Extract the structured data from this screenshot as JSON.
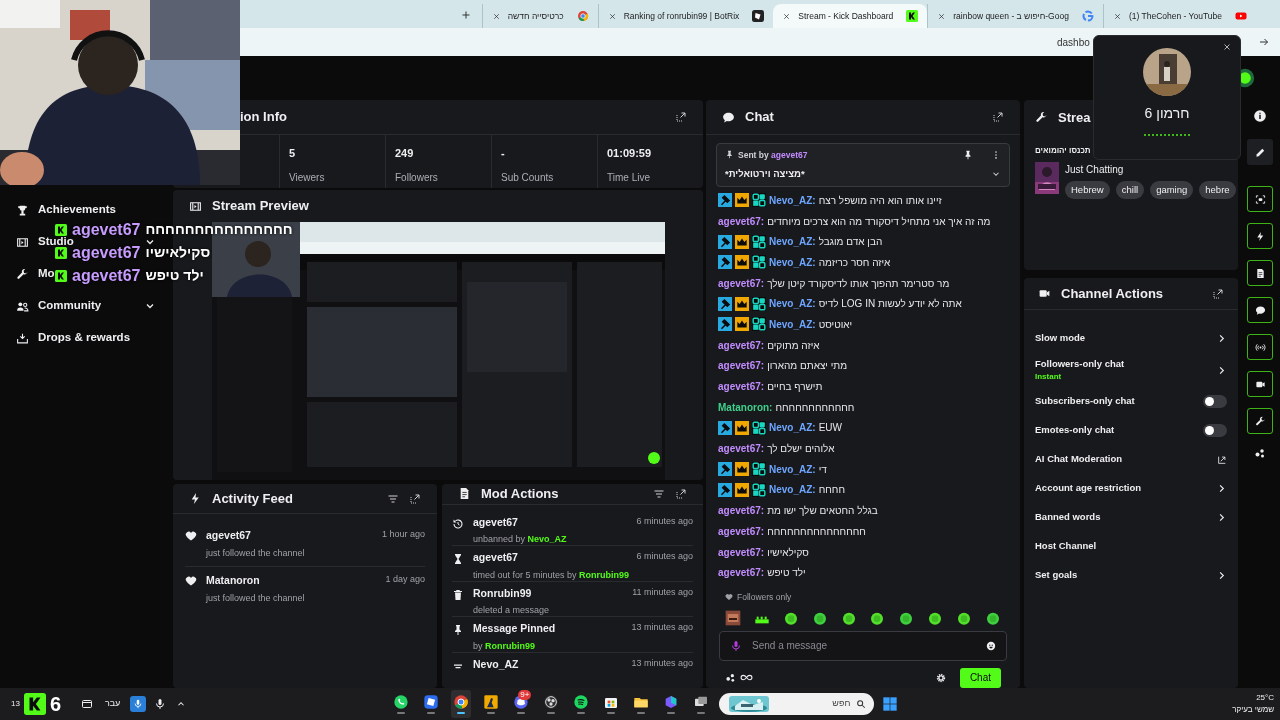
{
  "browser": {
    "tabs": [
      {
        "title": "כרטיסייה חדשה",
        "kind": "chrome",
        "selected": false
      },
      {
        "title": "Ranking of ronrubin99 | BotRix",
        "kind": "botrix",
        "selected": false
      },
      {
        "title": "Stream - Kick Dashboard",
        "kind": "kick",
        "selected": true
      },
      {
        "title": "rainbow queen - חיפוש ב-Goog",
        "kind": "google",
        "selected": false
      },
      {
        "title": "(1) TheCohen - YouTube",
        "kind": "youtube",
        "selected": false
      }
    ],
    "address": "dashbo"
  },
  "stream_overlay_chat": [
    {
      "user": "agevet67",
      "text": "חחחחחחחחחחחחחחח"
    },
    {
      "user": "agevet67",
      "text": "סקילאישיו"
    },
    {
      "user": "agevet67",
      "text": "ילד טיפש"
    }
  ],
  "sidebar": {
    "items": [
      {
        "label": "Achievements",
        "kind": "trophy",
        "expandable": false
      },
      {
        "label": "Studio",
        "kind": "studio",
        "expandable": true
      },
      {
        "label": "Mo",
        "kind": "wrench",
        "expandable": false
      },
      {
        "label": "Community",
        "kind": "community",
        "expandable": true
      },
      {
        "label": "Drops & rewards",
        "kind": "drops",
        "expandable": false
      }
    ]
  },
  "session_info": {
    "title": "ion Info",
    "stats": [
      {
        "value": "5",
        "label": "Viewers"
      },
      {
        "value": "249",
        "label": "Followers"
      },
      {
        "value": "-",
        "label": "Sub Counts"
      },
      {
        "value": "01:09:59",
        "label": "Time Live"
      }
    ]
  },
  "stream_preview": {
    "title": "Stream Preview"
  },
  "activity_feed": {
    "title": "Activity Feed",
    "items": [
      {
        "user": "agevet67",
        "event": "just followed the channel",
        "time": "1 hour ago"
      },
      {
        "user": "Matanoron",
        "event": "just followed the channel",
        "time": "1 day ago"
      }
    ]
  },
  "mod_actions": {
    "title": "Mod Actions",
    "items": [
      {
        "kind": "unban",
        "user": "agevet67",
        "action": "unbanned by",
        "by": "Nevo_AZ",
        "time": "6 minutes ago"
      },
      {
        "kind": "timeout",
        "user": "agevet67",
        "action": "timed out for 5 minutes by",
        "by": "Ronrubin99",
        "time": "6 minutes ago"
      },
      {
        "kind": "delete",
        "user": "Ronrubin99",
        "action": "deleted a message",
        "time": "11 minutes ago"
      },
      {
        "kind": "pin",
        "user": "Message Pinned",
        "action": "by",
        "by": "Ronrubin99",
        "time": "13 minutes ago"
      },
      {
        "kind": "other",
        "user": "Nevo_AZ",
        "time": "13 minutes ago"
      }
    ]
  },
  "chat": {
    "title": "Chat",
    "pinned": {
      "label": "Sent by",
      "user": "agevet67",
      "text": "*מציצה וירטואלית*"
    },
    "messages": [
      {
        "user": "Nevo_AZ:",
        "badges": true,
        "color": "#6ea6ff",
        "text": "זיינו אותו הוא היה מושפל רצח"
      },
      {
        "user": "agevet67:",
        "badges": false,
        "color": "#c28cff",
        "text": "מה זה איך אני מתחיל דיסקורד מה הוא צרכים מיוחדים"
      },
      {
        "user": "Nevo_AZ:",
        "badges": true,
        "color": "#6ea6ff",
        "text": "הבן אדם מוגבל"
      },
      {
        "user": "Nevo_AZ:",
        "badges": true,
        "color": "#6ea6ff",
        "text": "איזה חסר כריזמה"
      },
      {
        "user": "agevet67:",
        "badges": false,
        "color": "#c28cff",
        "text": "מר סטרימר תהפוך אותו לדיסקורד קיטן שלך"
      },
      {
        "user": "Nevo_AZ:",
        "badges": true,
        "color": "#6ea6ff",
        "text": "אתה לא יודע לעשות LOG IN לדיס"
      },
      {
        "user": "Nevo_AZ:",
        "badges": true,
        "color": "#6ea6ff",
        "text": "יאוטיסט"
      },
      {
        "user": "agevet67:",
        "badges": false,
        "color": "#c28cff",
        "text": "איזה מתוקים"
      },
      {
        "user": "agevet67:",
        "badges": false,
        "color": "#c28cff",
        "text": "מתי יצאתם מהארון"
      },
      {
        "user": "agevet67:",
        "badges": false,
        "color": "#c28cff",
        "text": "תישרף בחיים"
      },
      {
        "user": "Matanoron:",
        "badges": false,
        "color": "#3fd08c",
        "text": "חחחחחחחחחחחח"
      },
      {
        "user": "Nevo_AZ:",
        "badges": true,
        "color": "#6ea6ff",
        "text": "EUW"
      },
      {
        "user": "agevet67:",
        "badges": false,
        "color": "#c28cff",
        "text": "אלוהים ישלם לך"
      },
      {
        "user": "Nevo_AZ:",
        "badges": true,
        "color": "#6ea6ff",
        "text": "די"
      },
      {
        "user": "Nevo_AZ:",
        "badges": true,
        "color": "#6ea6ff",
        "text": "חחחח"
      },
      {
        "user": "agevet67:",
        "badges": false,
        "color": "#c28cff",
        "text": "בגלל החטאים שלך ישו מת"
      },
      {
        "user": "agevet67:",
        "badges": false,
        "color": "#c28cff",
        "text": "חחחחחחחחחחחחחחח"
      },
      {
        "user": "agevet67:",
        "badges": false,
        "color": "#c28cff",
        "text": "סקילאישיו"
      },
      {
        "user": "agevet67:",
        "badges": false,
        "color": "#c28cff",
        "text": "ילד טיפש"
      }
    ],
    "mode": "Followers only",
    "placeholder": "Send a message",
    "send_button": "Chat"
  },
  "stream_info": {
    "title": "Strea",
    "stream_title": "תכנסו יהומואים",
    "category": "Just Chatting",
    "tags": [
      "Hebrew",
      "chill",
      "gaming",
      "hebre"
    ]
  },
  "channel_actions": {
    "title": "Channel Actions",
    "items": [
      {
        "label": "Slow mode",
        "kind": "chevron"
      },
      {
        "label": "Followers-only chat",
        "kind": "chevron",
        "sub": "Instant"
      },
      {
        "label": "Subscribers-only chat",
        "kind": "toggle",
        "on": false
      },
      {
        "label": "Emotes-only chat",
        "kind": "toggle",
        "on": false
      },
      {
        "label": "AI Chat Moderation",
        "kind": "external"
      },
      {
        "label": "Account age restriction",
        "kind": "chevron"
      },
      {
        "label": "Banned words",
        "kind": "chevron"
      },
      {
        "label": "Host Channel",
        "kind": "plain"
      },
      {
        "label": "Set goals",
        "kind": "chevron"
      }
    ]
  },
  "profile_popup": {
    "name": "חרמון 6"
  },
  "taskbar": {
    "clock": "13",
    "widget_count": "6",
    "language": "עבר",
    "apps": [
      {
        "kind": "whatsapp",
        "selected": false
      },
      {
        "kind": "roblox",
        "selected": false
      },
      {
        "kind": "chrome",
        "selected": true
      },
      {
        "kind": "cs",
        "selected": false
      },
      {
        "kind": "discord",
        "selected": false,
        "badge": "9+"
      },
      {
        "kind": "obs",
        "selected": false
      },
      {
        "kind": "spotify",
        "selected": false
      },
      {
        "kind": "store",
        "selected": false
      },
      {
        "kind": "files",
        "selected": false
      },
      {
        "kind": "m365",
        "selected": false
      },
      {
        "kind": "taskview",
        "selected": false
      }
    ],
    "search_placeholder": "חפש",
    "temperature": "25°C",
    "weather": "שמשי בעיקר"
  }
}
